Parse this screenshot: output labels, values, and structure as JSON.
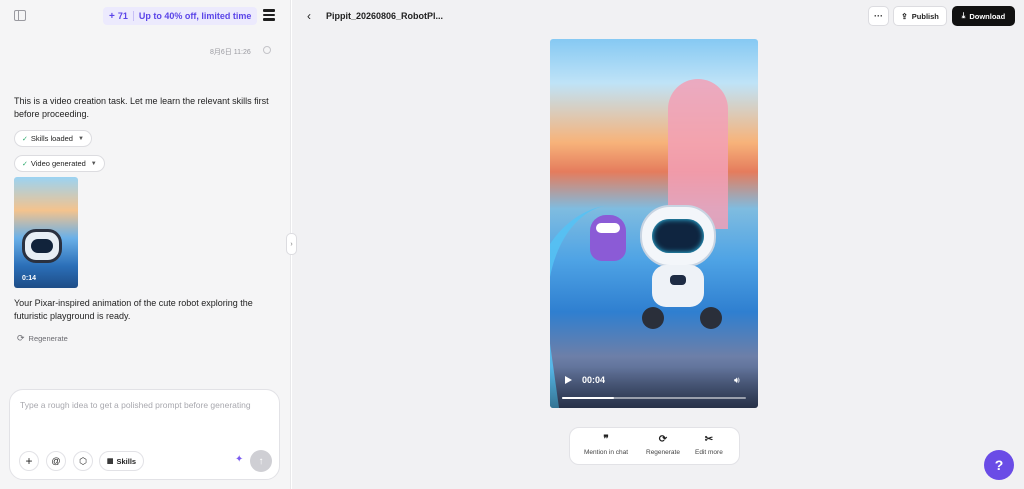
{
  "header": {
    "promo_credits": "71",
    "promo_text": "Up to 40% off, limited time"
  },
  "chat": {
    "timestamp": "8月6日 11:26",
    "message1": "This is a video creation task. Let me learn the relevant skills first before proceeding.",
    "pill_skills": "Skills loaded",
    "pill_video": "Video generated",
    "thumb_duration": "0:14",
    "message2": "Your Pixar-inspired animation of the cute robot exploring the futuristic playground is ready.",
    "regenerate_label": "Regenerate"
  },
  "composer": {
    "placeholder": "Type a rough idea to get a polished prompt before generating",
    "skills_label": "Skills"
  },
  "project": {
    "title": "Pippit_20260806_RobotPl...",
    "more_label": "···",
    "publish_label": "Publish",
    "download_label": "Download"
  },
  "player": {
    "time": "00:04",
    "progress": 0.28
  },
  "actions": {
    "mention_label": "Mention in chat",
    "regenerate_label": "Regenerate",
    "edit_label": "Edit more"
  },
  "help": {
    "label": "?"
  },
  "colors": {
    "accent": "#6a4ce6",
    "promo_text": "#5b45e8",
    "download_bg": "#111111"
  },
  "icons": {
    "sidebar": "sidebar-toggle-icon",
    "layers": "layers-icon",
    "back": "chevron-left-icon",
    "publish": "upload-icon",
    "download": "download-icon",
    "play": "play-icon",
    "volume": "volume-icon",
    "mention": "quote-icon",
    "regenerate": "refresh-icon",
    "edit": "scissors-icon"
  }
}
